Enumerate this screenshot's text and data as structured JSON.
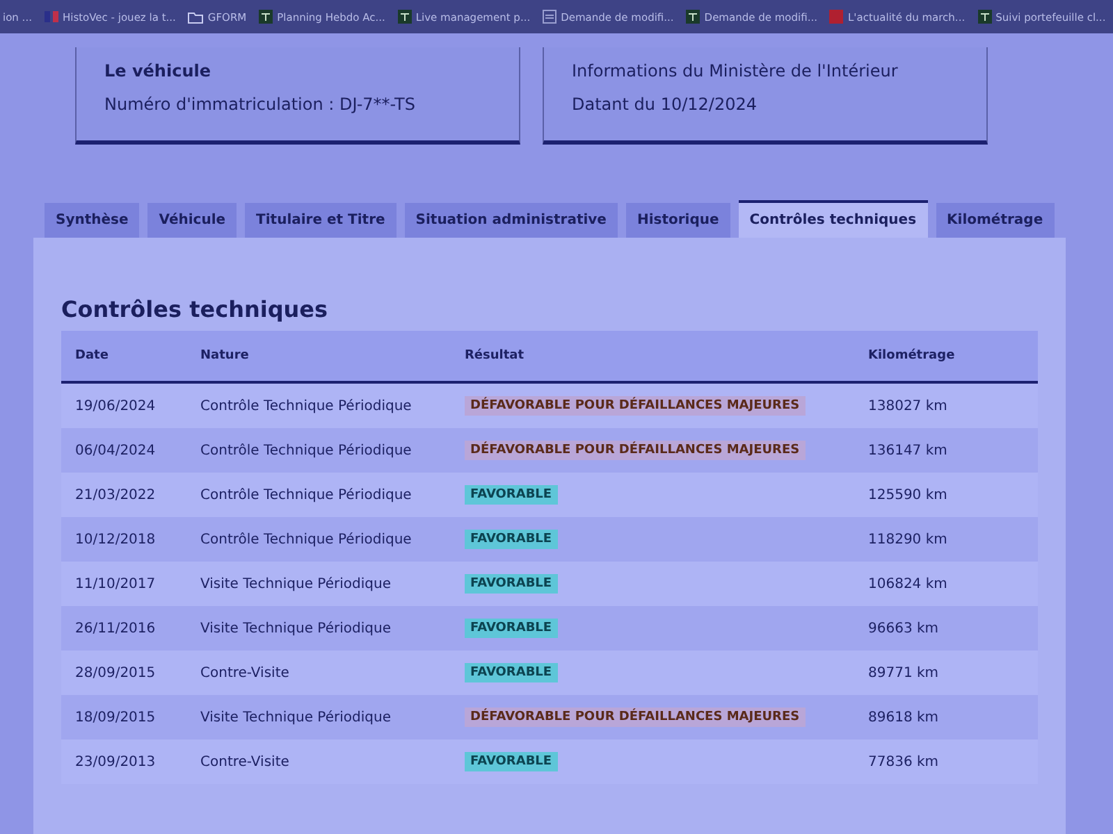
{
  "bookmarks": [
    {
      "label": "ion ...",
      "kind": "plain"
    },
    {
      "label": "HistoVec - jouez la t...",
      "kind": "flag"
    },
    {
      "label": "GFORM",
      "kind": "folder"
    },
    {
      "label": "Planning Hebdo Ac...",
      "kind": "sheet"
    },
    {
      "label": "Live management p...",
      "kind": "sheet"
    },
    {
      "label": "Demande de modifi...",
      "kind": "doc"
    },
    {
      "label": "Demande de modifi...",
      "kind": "sheet"
    },
    {
      "label": "L'actualité du march...",
      "kind": "news"
    },
    {
      "label": "Suivi portefeuille cl...",
      "kind": "sheet"
    }
  ],
  "cards": [
    {
      "title": "Le véhicule",
      "text": "Numéro d'immatriculation : DJ-7**-TS"
    },
    {
      "title": "Informations du Ministère de l'Intérieur",
      "text": "Datant du 10/12/2024"
    }
  ],
  "tabs": [
    {
      "label": "Synthèse",
      "selected": false
    },
    {
      "label": "Véhicule",
      "selected": false
    },
    {
      "label": "Titulaire et Titre",
      "selected": false
    },
    {
      "label": "Situation administrative",
      "selected": false
    },
    {
      "label": "Historique",
      "selected": false
    },
    {
      "label": "Contrôles techniques",
      "selected": true
    },
    {
      "label": "Kilométrage",
      "selected": false
    }
  ],
  "section_title": "Contrôles techniques",
  "table": {
    "columns": [
      "Date",
      "Nature",
      "Résultat",
      "Kilométrage"
    ],
    "rows": [
      {
        "date": "19/06/2024",
        "nature": "Contrôle Technique Périodique",
        "result": "DÉFAVORABLE POUR DÉFAILLANCES MAJEURES",
        "kind": "unfavorable",
        "km": "138027 km"
      },
      {
        "date": "06/04/2024",
        "nature": "Contrôle Technique Périodique",
        "result": "DÉFAVORABLE POUR DÉFAILLANCES MAJEURES",
        "kind": "unfavorable",
        "km": "136147 km"
      },
      {
        "date": "21/03/2022",
        "nature": "Contrôle Technique Périodique",
        "result": "FAVORABLE",
        "kind": "favorable",
        "km": "125590 km"
      },
      {
        "date": "10/12/2018",
        "nature": "Contrôle Technique Périodique",
        "result": "FAVORABLE",
        "kind": "favorable",
        "km": "118290 km"
      },
      {
        "date": "11/10/2017",
        "nature": "Visite Technique Périodique",
        "result": "FAVORABLE",
        "kind": "favorable",
        "km": "106824 km"
      },
      {
        "date": "26/11/2016",
        "nature": "Visite Technique Périodique",
        "result": "FAVORABLE",
        "kind": "favorable",
        "km": "96663 km"
      },
      {
        "date": "28/09/2015",
        "nature": "Contre-Visite",
        "result": "FAVORABLE",
        "kind": "favorable",
        "km": "89771 km"
      },
      {
        "date": "18/09/2015",
        "nature": "Visite Technique Périodique",
        "result": "DÉFAVORABLE POUR DÉFAILLANCES MAJEURES",
        "kind": "unfavorable",
        "km": "89618 km"
      },
      {
        "date": "23/09/2013",
        "nature": "Contre-Visite",
        "result": "FAVORABLE",
        "kind": "favorable",
        "km": "77836 km"
      }
    ]
  }
}
